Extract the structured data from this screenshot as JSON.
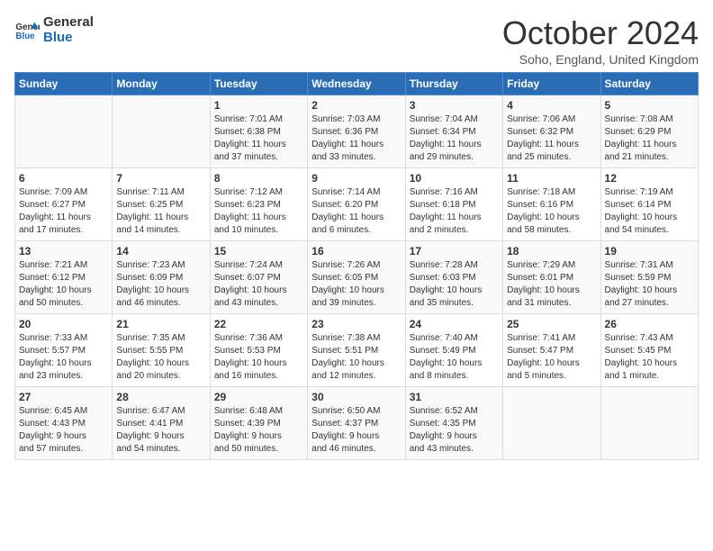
{
  "logo": {
    "line1": "General",
    "line2": "Blue"
  },
  "title": "October 2024",
  "location": "Soho, England, United Kingdom",
  "days_of_week": [
    "Sunday",
    "Monday",
    "Tuesday",
    "Wednesday",
    "Thursday",
    "Friday",
    "Saturday"
  ],
  "weeks": [
    [
      {
        "day": "",
        "info": ""
      },
      {
        "day": "",
        "info": ""
      },
      {
        "day": "1",
        "info": "Sunrise: 7:01 AM\nSunset: 6:38 PM\nDaylight: 11 hours\nand 37 minutes."
      },
      {
        "day": "2",
        "info": "Sunrise: 7:03 AM\nSunset: 6:36 PM\nDaylight: 11 hours\nand 33 minutes."
      },
      {
        "day": "3",
        "info": "Sunrise: 7:04 AM\nSunset: 6:34 PM\nDaylight: 11 hours\nand 29 minutes."
      },
      {
        "day": "4",
        "info": "Sunrise: 7:06 AM\nSunset: 6:32 PM\nDaylight: 11 hours\nand 25 minutes."
      },
      {
        "day": "5",
        "info": "Sunrise: 7:08 AM\nSunset: 6:29 PM\nDaylight: 11 hours\nand 21 minutes."
      }
    ],
    [
      {
        "day": "6",
        "info": "Sunrise: 7:09 AM\nSunset: 6:27 PM\nDaylight: 11 hours\nand 17 minutes."
      },
      {
        "day": "7",
        "info": "Sunrise: 7:11 AM\nSunset: 6:25 PM\nDaylight: 11 hours\nand 14 minutes."
      },
      {
        "day": "8",
        "info": "Sunrise: 7:12 AM\nSunset: 6:23 PM\nDaylight: 11 hours\nand 10 minutes."
      },
      {
        "day": "9",
        "info": "Sunrise: 7:14 AM\nSunset: 6:20 PM\nDaylight: 11 hours\nand 6 minutes."
      },
      {
        "day": "10",
        "info": "Sunrise: 7:16 AM\nSunset: 6:18 PM\nDaylight: 11 hours\nand 2 minutes."
      },
      {
        "day": "11",
        "info": "Sunrise: 7:18 AM\nSunset: 6:16 PM\nDaylight: 10 hours\nand 58 minutes."
      },
      {
        "day": "12",
        "info": "Sunrise: 7:19 AM\nSunset: 6:14 PM\nDaylight: 10 hours\nand 54 minutes."
      }
    ],
    [
      {
        "day": "13",
        "info": "Sunrise: 7:21 AM\nSunset: 6:12 PM\nDaylight: 10 hours\nand 50 minutes."
      },
      {
        "day": "14",
        "info": "Sunrise: 7:23 AM\nSunset: 6:09 PM\nDaylight: 10 hours\nand 46 minutes."
      },
      {
        "day": "15",
        "info": "Sunrise: 7:24 AM\nSunset: 6:07 PM\nDaylight: 10 hours\nand 43 minutes."
      },
      {
        "day": "16",
        "info": "Sunrise: 7:26 AM\nSunset: 6:05 PM\nDaylight: 10 hours\nand 39 minutes."
      },
      {
        "day": "17",
        "info": "Sunrise: 7:28 AM\nSunset: 6:03 PM\nDaylight: 10 hours\nand 35 minutes."
      },
      {
        "day": "18",
        "info": "Sunrise: 7:29 AM\nSunset: 6:01 PM\nDaylight: 10 hours\nand 31 minutes."
      },
      {
        "day": "19",
        "info": "Sunrise: 7:31 AM\nSunset: 5:59 PM\nDaylight: 10 hours\nand 27 minutes."
      }
    ],
    [
      {
        "day": "20",
        "info": "Sunrise: 7:33 AM\nSunset: 5:57 PM\nDaylight: 10 hours\nand 23 minutes."
      },
      {
        "day": "21",
        "info": "Sunrise: 7:35 AM\nSunset: 5:55 PM\nDaylight: 10 hours\nand 20 minutes."
      },
      {
        "day": "22",
        "info": "Sunrise: 7:36 AM\nSunset: 5:53 PM\nDaylight: 10 hours\nand 16 minutes."
      },
      {
        "day": "23",
        "info": "Sunrise: 7:38 AM\nSunset: 5:51 PM\nDaylight: 10 hours\nand 12 minutes."
      },
      {
        "day": "24",
        "info": "Sunrise: 7:40 AM\nSunset: 5:49 PM\nDaylight: 10 hours\nand 8 minutes."
      },
      {
        "day": "25",
        "info": "Sunrise: 7:41 AM\nSunset: 5:47 PM\nDaylight: 10 hours\nand 5 minutes."
      },
      {
        "day": "26",
        "info": "Sunrise: 7:43 AM\nSunset: 5:45 PM\nDaylight: 10 hours\nand 1 minute."
      }
    ],
    [
      {
        "day": "27",
        "info": "Sunrise: 6:45 AM\nSunset: 4:43 PM\nDaylight: 9 hours\nand 57 minutes."
      },
      {
        "day": "28",
        "info": "Sunrise: 6:47 AM\nSunset: 4:41 PM\nDaylight: 9 hours\nand 54 minutes."
      },
      {
        "day": "29",
        "info": "Sunrise: 6:48 AM\nSunset: 4:39 PM\nDaylight: 9 hours\nand 50 minutes."
      },
      {
        "day": "30",
        "info": "Sunrise: 6:50 AM\nSunset: 4:37 PM\nDaylight: 9 hours\nand 46 minutes."
      },
      {
        "day": "31",
        "info": "Sunrise: 6:52 AM\nSunset: 4:35 PM\nDaylight: 9 hours\nand 43 minutes."
      },
      {
        "day": "",
        "info": ""
      },
      {
        "day": "",
        "info": ""
      }
    ]
  ]
}
